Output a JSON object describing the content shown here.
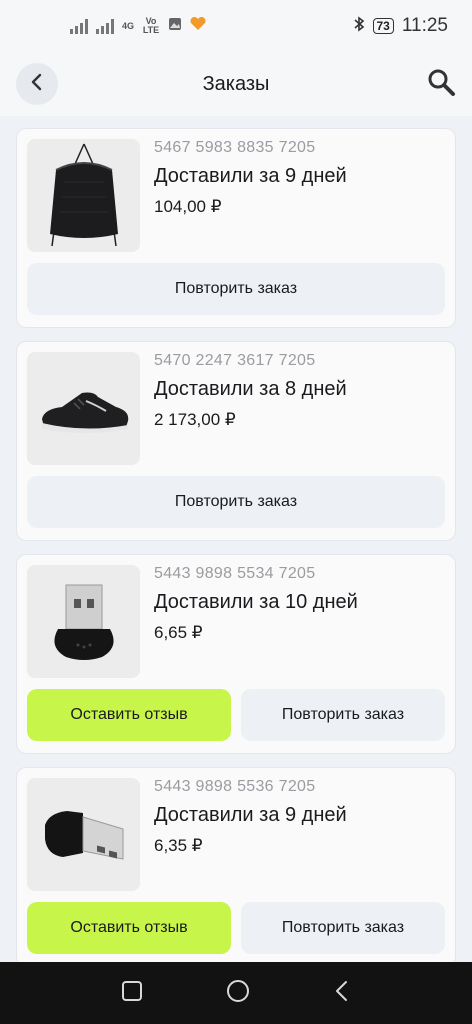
{
  "status_bar": {
    "net_label": "4G",
    "volte_label": "Vo LTE",
    "battery": "73",
    "time": "11:25"
  },
  "header": {
    "title": "Заказы",
    "back_icon": "chevron-left-icon",
    "search_icon": "search-icon"
  },
  "orders": [
    {
      "number": "5467 5983 8835 7205",
      "status": "Доставили за 9 дней",
      "price": "104,00 ₽",
      "image": "drawstring-bag",
      "repeat_label": "Повторить заказ"
    },
    {
      "number": "5470 2247 3617 7205",
      "status": "Доставили за 8 дней",
      "price": "2 173,00 ₽",
      "image": "sneaker",
      "repeat_label": "Повторить заказ"
    },
    {
      "number": "5443 9898 5534 7205",
      "status": "Доставили за 10 дней",
      "price": "6,65 ₽",
      "image": "usb-microphone",
      "review_label": "Оставить отзыв",
      "repeat_label": "Повторить заказ"
    },
    {
      "number": "5443 9898 5536 7205",
      "status": "Доставили за 9 дней",
      "price": "6,35 ₽",
      "image": "usb-microphone",
      "review_label": "Оставить отзыв",
      "repeat_label": "Повторить заказ"
    }
  ],
  "colors": {
    "accent_review": "#c8f54a",
    "button_bg": "#edf0f4",
    "page_bg": "#eef1f5"
  }
}
